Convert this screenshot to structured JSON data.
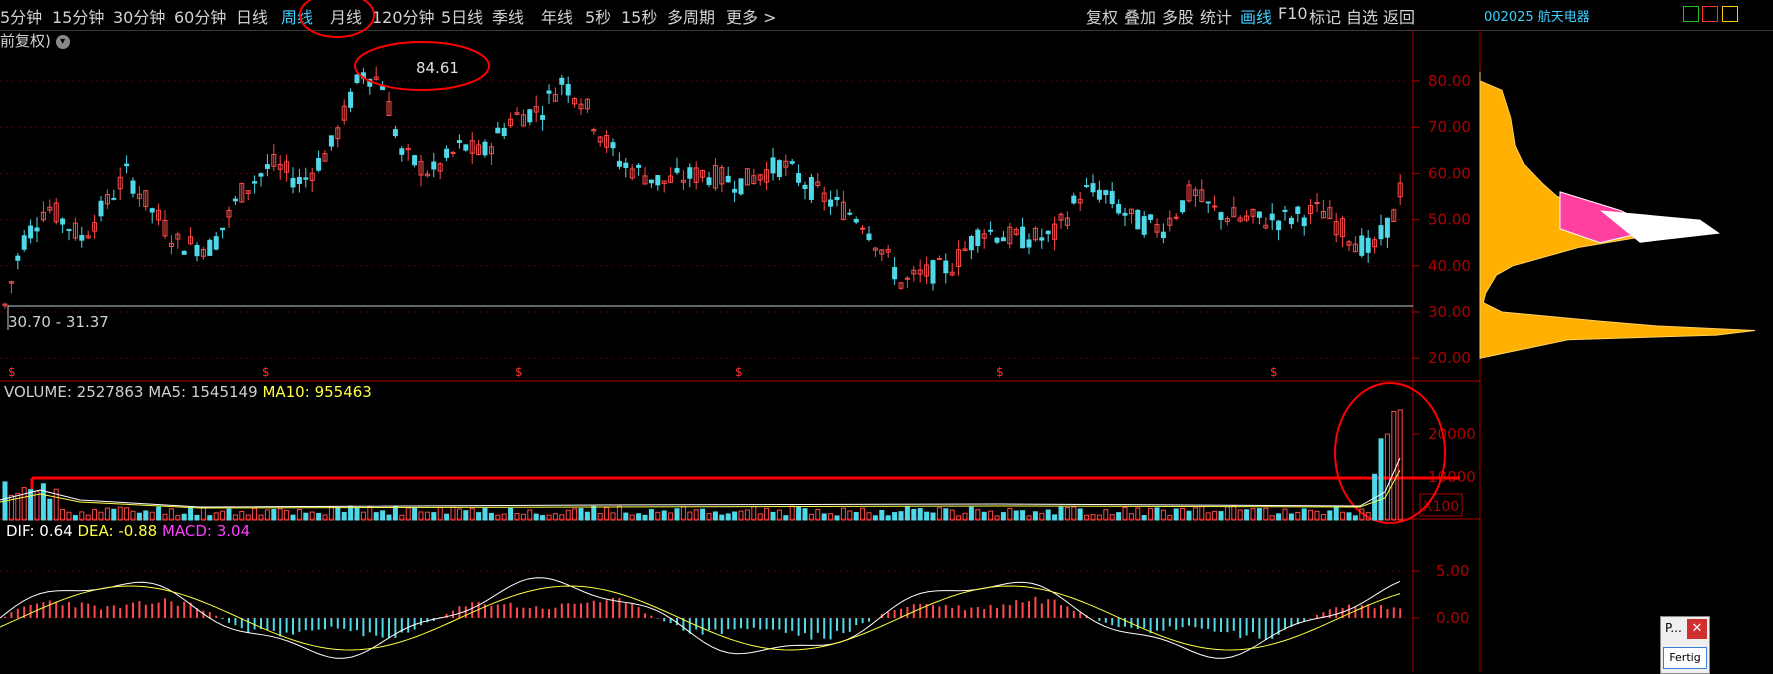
{
  "toolbar": {
    "periods": [
      "5分钟",
      "15分钟",
      "30分钟",
      "60分钟",
      "日线",
      "周线",
      "月线",
      "120分钟",
      "5日线",
      "季线",
      "年线",
      "5秒",
      "15秒",
      "多周期",
      "更多 >"
    ],
    "active_period": "周线",
    "tools": [
      "复权",
      "叠加",
      "多股",
      "统计",
      "画线",
      "F10",
      "标记",
      "自选",
      "返回"
    ],
    "active_tool": "画线",
    "stock_code": "002025",
    "stock_name": "航天电器"
  },
  "price_panel": {
    "mode_label": "前复权)",
    "high_marker": "84.61",
    "range_label": "30.70 - 31.37",
    "axis_ticks": [
      "80.00",
      "70.00",
      "60.00",
      "50.00",
      "40.00",
      "30.00",
      "20.00"
    ]
  },
  "volume_panel": {
    "title_prefix": "VOLUME:",
    "volume": "2527863",
    "ma5_label": "MA5:",
    "ma5": "1545149",
    "ma10_label": "MA10:",
    "ma10": "955463",
    "axis_ticks": [
      "20000",
      "10000"
    ],
    "unit": "X100"
  },
  "macd_panel": {
    "dif_label": "DIF:",
    "dif": "0.64",
    "dea_label": "DEA:",
    "dea": "-0.88",
    "macd_label": "MACD:",
    "macd": "3.04",
    "axis_ticks": [
      "5.00",
      "0.00"
    ]
  },
  "popup": {
    "title": "P...",
    "close": "✕",
    "button": "Fertig"
  },
  "colors": {
    "up": "#ff4a4a",
    "down": "#4fd8e8",
    "axis": "#b00000",
    "dif": "#ffffff",
    "dea": "#ffff40",
    "macd_label": "#ff40ff",
    "annotation": "#ff0000",
    "chip_profile": "#ffb000"
  }
}
